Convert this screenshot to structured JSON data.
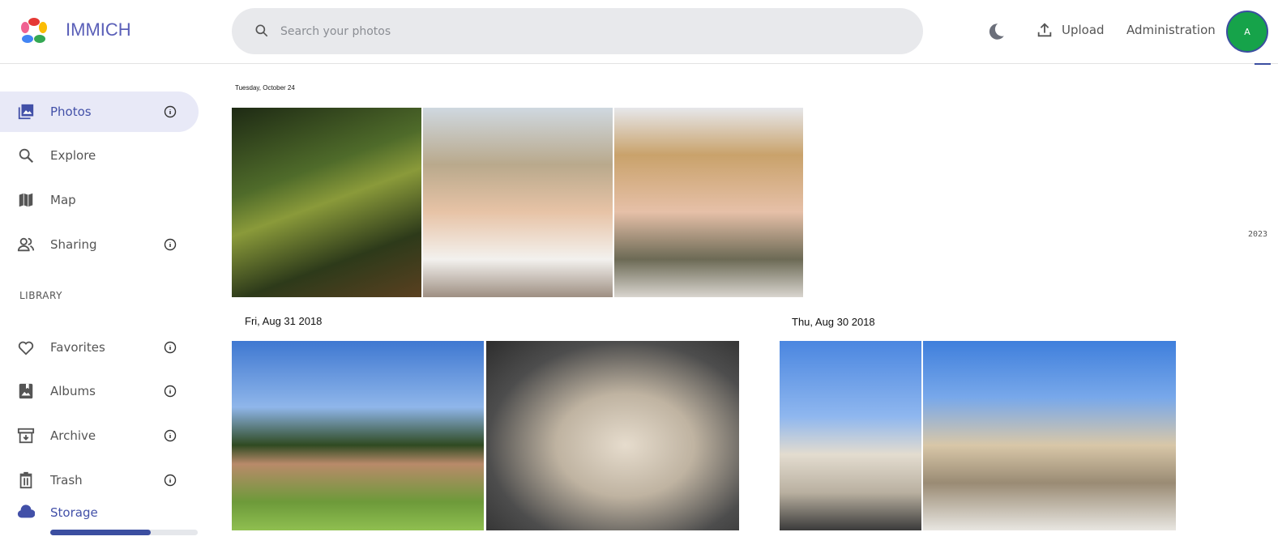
{
  "header": {
    "brand": "IMMICH",
    "search_placeholder": "Search your photos",
    "upload_label": "Upload",
    "admin_label": "Administration",
    "avatar_initial": "A"
  },
  "sidebar": {
    "items": [
      {
        "label": "Photos"
      },
      {
        "label": "Explore"
      },
      {
        "label": "Map"
      },
      {
        "label": "Sharing"
      }
    ],
    "section_label": "LIBRARY",
    "library": [
      {
        "label": "Favorites"
      },
      {
        "label": "Albums"
      },
      {
        "label": "Archive"
      },
      {
        "label": "Trash"
      }
    ],
    "storage_label": "Storage",
    "storage_used_percent": 68
  },
  "timeline": {
    "groups": [
      {
        "date": "Tuesday, October 24"
      },
      {
        "date": "Fri, Aug 31 2018"
      },
      {
        "date": "Thu, Aug 30 2018"
      }
    ],
    "scrubber_year": "2023"
  },
  "colors": {
    "accent": "#4250a8",
    "avatar": "#16a34a"
  }
}
